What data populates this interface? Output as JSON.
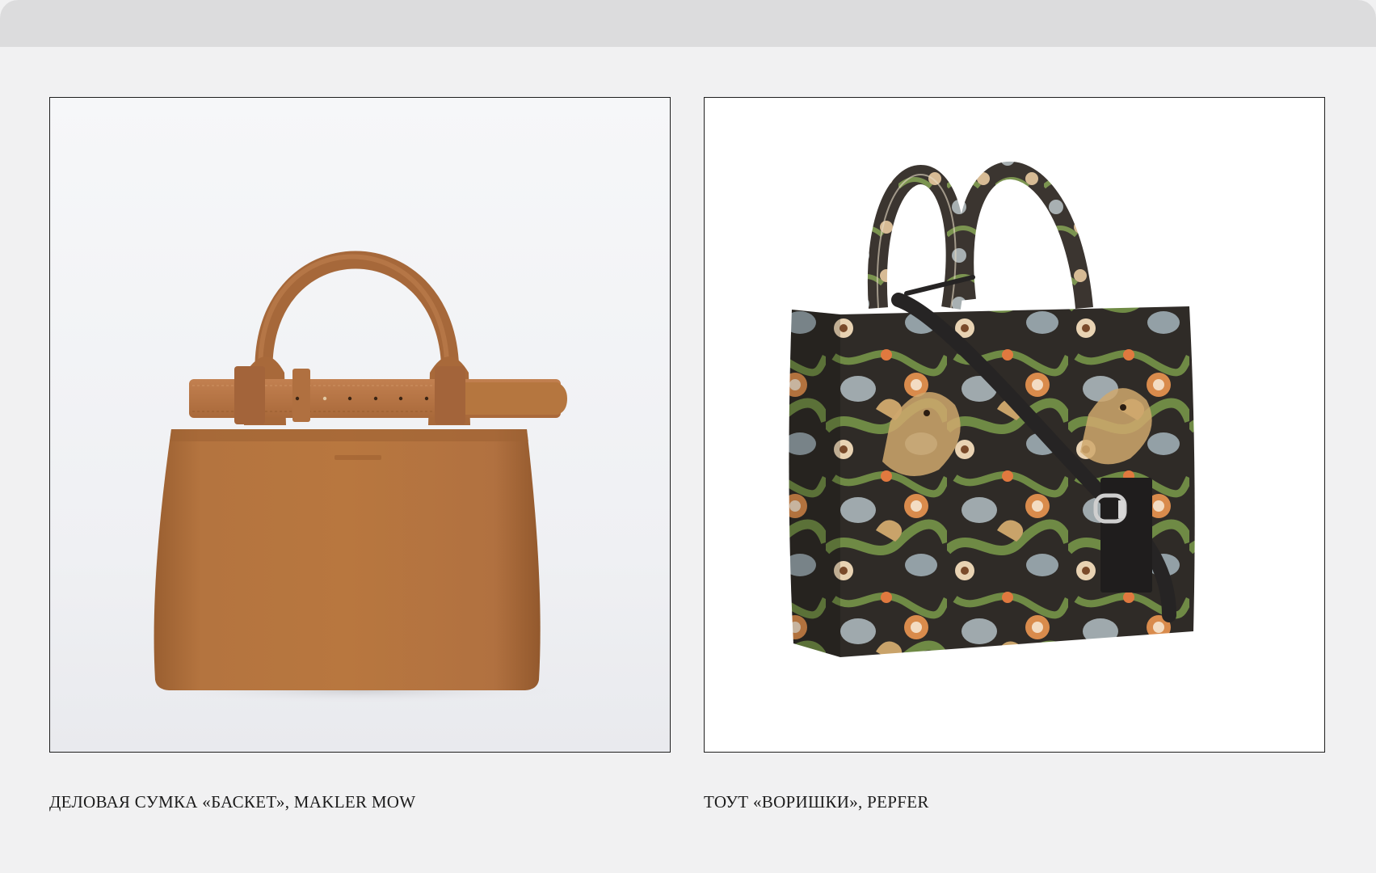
{
  "products": [
    {
      "caption": "ДЕЛОВАЯ СУМКА «БАСКЕТ», MAKLER MOW",
      "image_subject": "brown-leather-belted-handbag",
      "main_color": "#b0713f"
    },
    {
      "caption": "ТОУТ «ВОРИШКИ», PEPFER",
      "image_subject": "tapestry-floral-bird-tote-bag",
      "main_color": "#2e2a26"
    }
  ]
}
